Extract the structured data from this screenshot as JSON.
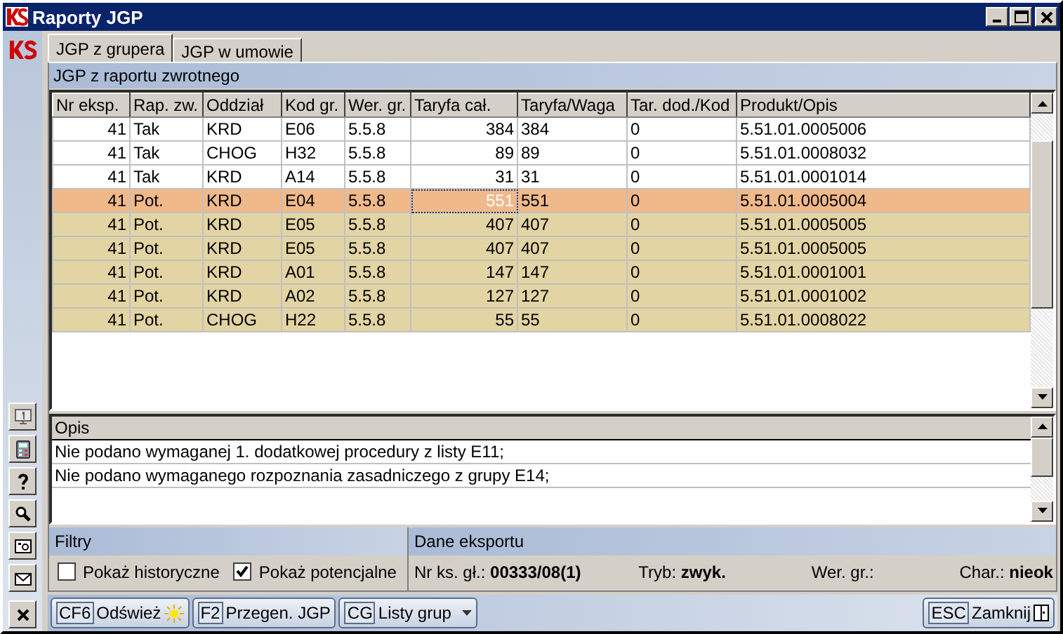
{
  "window": {
    "title": "Raporty JGP"
  },
  "tabs": [
    {
      "label": "JGP z grupera",
      "selected": true
    },
    {
      "label": "JGP w umowie",
      "selected": false
    }
  ],
  "section_title": "JGP z raportu zwrotnego",
  "table": {
    "columns": [
      "Nr eksp.",
      "Rap. zw.",
      "Oddział",
      "Kod gr.",
      "Wer. gr.",
      "Taryfa cał.",
      "Taryfa/Waga",
      "Tar. dod./Kod",
      "Produkt/Opis"
    ],
    "rows": [
      {
        "cells": [
          "41",
          "Tak",
          "KRD",
          "E06",
          "5.5.8",
          "384",
          "384",
          "0",
          "5.51.01.0005006"
        ],
        "potential": false,
        "selected": false
      },
      {
        "cells": [
          "41",
          "Tak",
          "CHOG",
          "H32",
          "5.5.8",
          "89",
          "89",
          "0",
          "5.51.01.0008032"
        ],
        "potential": false,
        "selected": false
      },
      {
        "cells": [
          "41",
          "Tak",
          "KRD",
          "A14",
          "5.5.8",
          "31",
          "31",
          "0",
          "5.51.01.0001014"
        ],
        "potential": false,
        "selected": false
      },
      {
        "cells": [
          "41",
          "Pot.",
          "KRD",
          "E04",
          "5.5.8",
          "551",
          "551",
          "0",
          "5.51.01.0005004"
        ],
        "potential": true,
        "selected": true
      },
      {
        "cells": [
          "41",
          "Pot.",
          "KRD",
          "E05",
          "5.5.8",
          "407",
          "407",
          "0",
          "5.51.01.0005005"
        ],
        "potential": true,
        "selected": false
      },
      {
        "cells": [
          "41",
          "Pot.",
          "KRD",
          "E05",
          "5.5.8",
          "407",
          "407",
          "0",
          "5.51.01.0005005"
        ],
        "potential": true,
        "selected": false
      },
      {
        "cells": [
          "41",
          "Pot.",
          "KRD",
          "A01",
          "5.5.8",
          "147",
          "147",
          "0",
          "5.51.01.0001001"
        ],
        "potential": true,
        "selected": false
      },
      {
        "cells": [
          "41",
          "Pot.",
          "KRD",
          "A02",
          "5.5.8",
          "127",
          "127",
          "0",
          "5.51.01.0001002"
        ],
        "potential": true,
        "selected": false
      },
      {
        "cells": [
          "41",
          "Pot.",
          "CHOG",
          "H22",
          "5.5.8",
          "55",
          "55",
          "0",
          "5.51.01.0008022"
        ],
        "potential": true,
        "selected": false
      }
    ]
  },
  "description": {
    "column": "Opis",
    "rows": [
      "Nie podano wymaganej 1. dodatkowej procedury z listy E11;",
      "Nie podano wymaganego rozpoznania zasadniczego z grupy E14;"
    ]
  },
  "filters": {
    "title": "Filtry",
    "options": [
      {
        "label": "Pokaż historyczne",
        "checked": false
      },
      {
        "label": "Pokaż potencjalne",
        "checked": true
      }
    ]
  },
  "export": {
    "title": "Dane eksportu",
    "fields": [
      {
        "label": "Nr ks. gł.:",
        "value": "00333/08(1)"
      },
      {
        "label": "Tryb:",
        "value": "zwyk."
      },
      {
        "label": "Wer. gr.:"
      },
      {
        "label": "Char.:",
        "value": "nieok"
      }
    ]
  },
  "sidebar_tools": [
    {
      "kind": "monitor"
    },
    {
      "kind": "calculator"
    },
    {
      "kind": "help"
    },
    {
      "kind": "search"
    },
    {
      "kind": "photo"
    },
    {
      "kind": "mail"
    },
    {
      "kind": "close"
    }
  ],
  "buttons": [
    {
      "key": "CF6",
      "label": "Odśwież",
      "kind": "refresh"
    },
    {
      "key": "F2",
      "label": "Przegen. JGP",
      "kind": "plain"
    },
    {
      "key": "CG",
      "label": "Listy grup",
      "kind": "dropdown"
    }
  ],
  "close_button": {
    "key": "ESC",
    "label": "Zamknij"
  }
}
